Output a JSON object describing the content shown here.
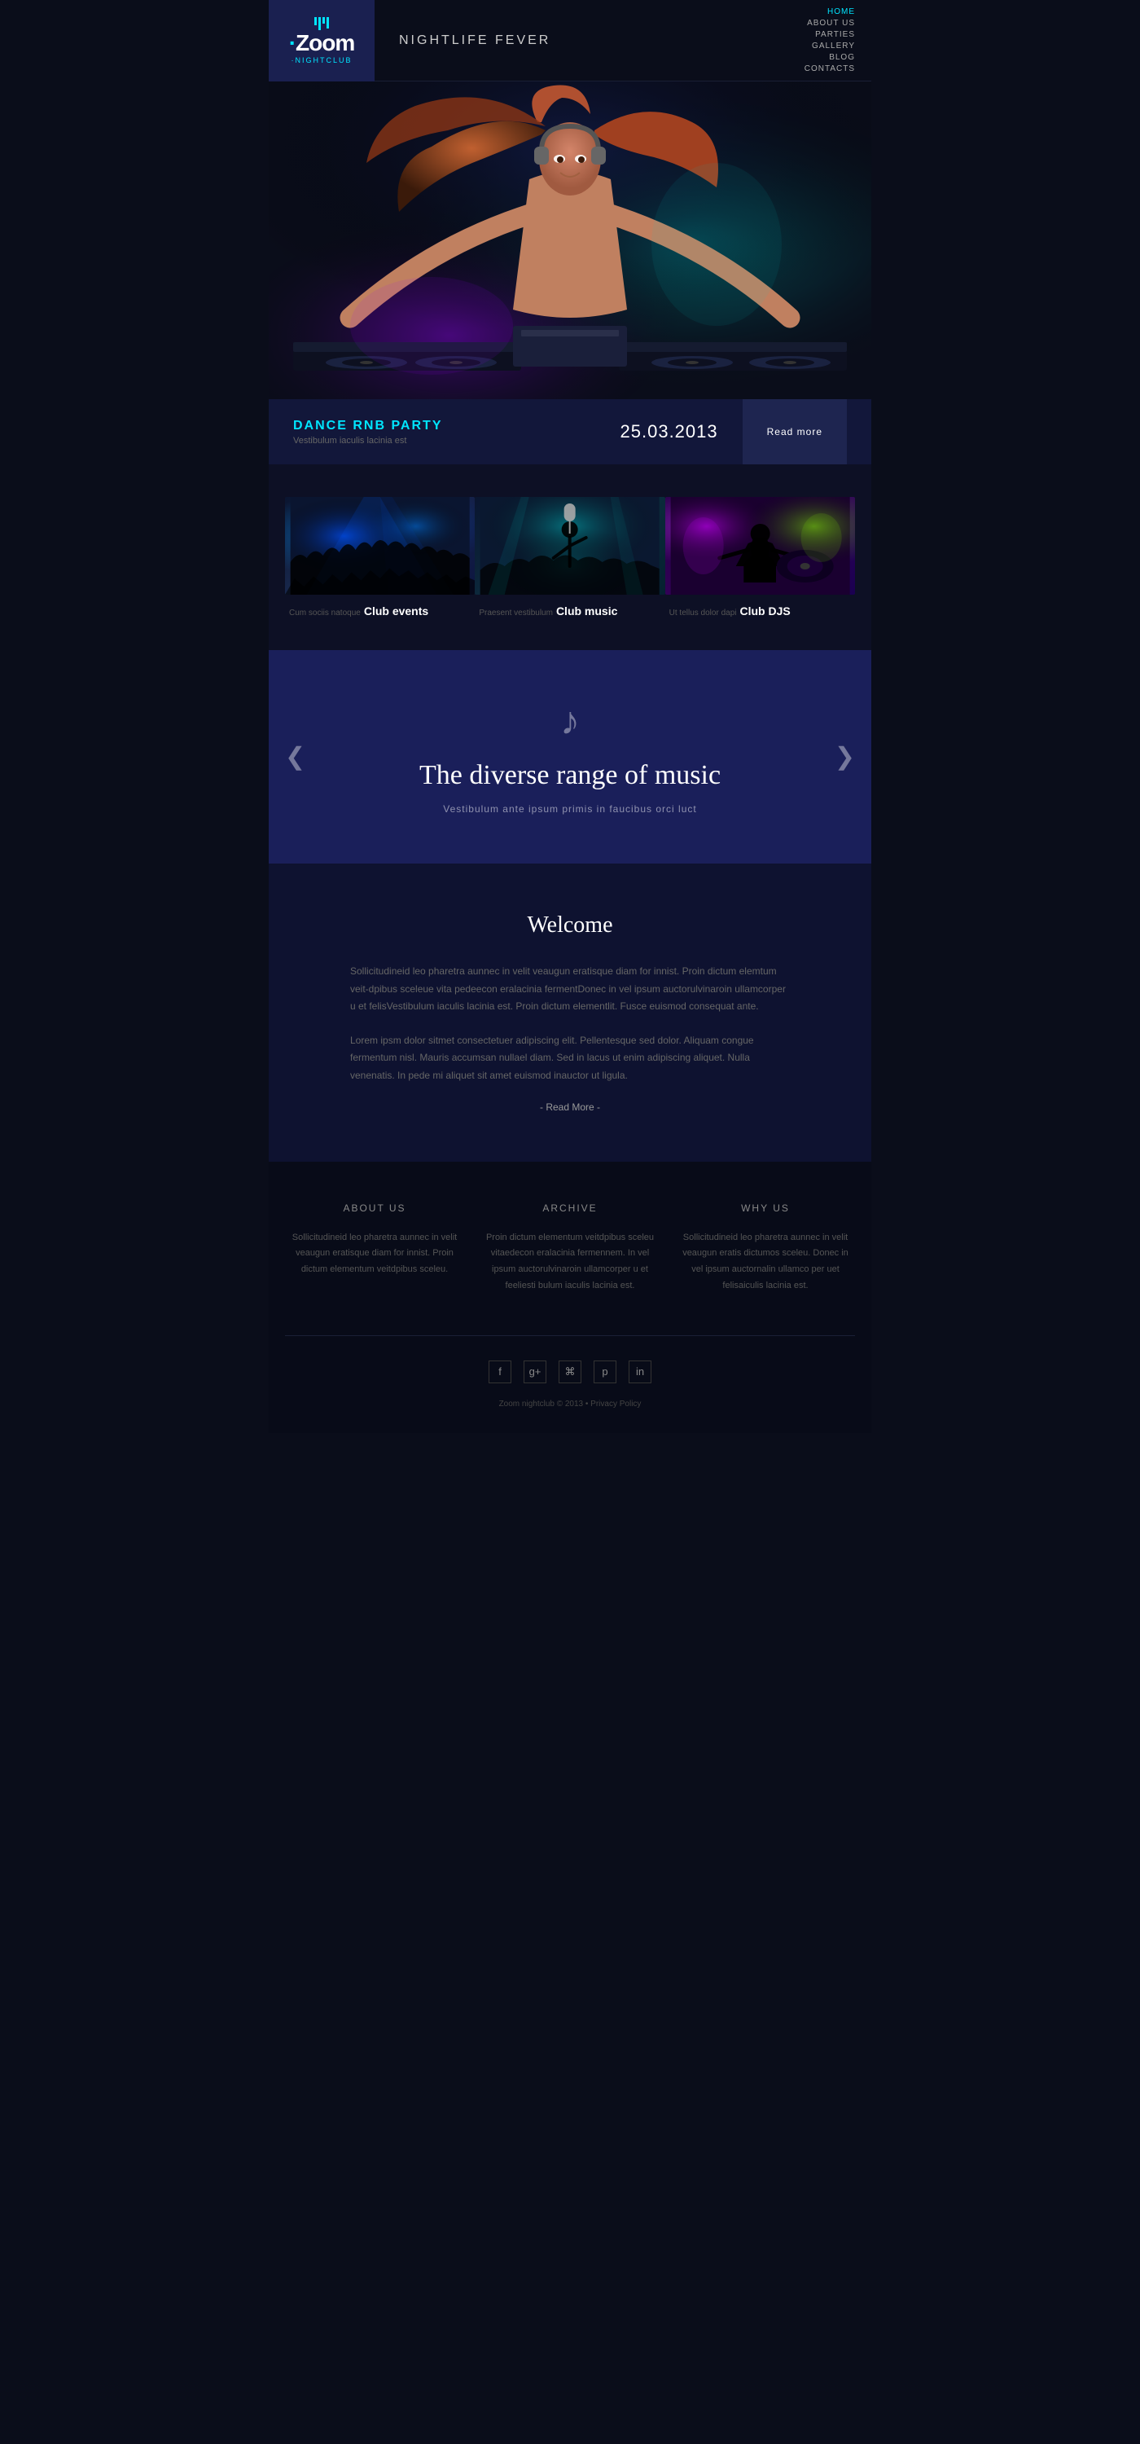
{
  "site": {
    "logo": {
      "main": "·Zoom",
      "sub": "·NIGHTCLUB",
      "dot": "·"
    },
    "header_title": "NIGHTLIFE FEVER",
    "nav": [
      {
        "label": "HOME",
        "active": true
      },
      {
        "label": "ABOUT US",
        "active": false
      },
      {
        "label": "PARTIES",
        "active": false
      },
      {
        "label": "GALLERY",
        "active": false
      },
      {
        "label": "BLOG",
        "active": false
      },
      {
        "label": "CONTACTS",
        "active": false
      }
    ]
  },
  "event_bar": {
    "title": "DANCE RNB PARTY",
    "subtitle": "Vestibulum iaculis lacinia est",
    "date": "25.03.2013",
    "read_more": "Read more"
  },
  "cards": [
    {
      "prefix": "Cum sociis natoque",
      "title": "Club events",
      "type": "club-events"
    },
    {
      "prefix": "Praesent vestibulum",
      "title": "Club music",
      "type": "club-music"
    },
    {
      "prefix": "Ut tellus dolor dapi",
      "title": "Club DJS",
      "type": "club-djs"
    }
  ],
  "music_slider": {
    "icon": "♪",
    "title": "The diverse range of music",
    "subtitle": "Vestibulum ante ipsum primis in faucibus orci luct",
    "prev": "❮",
    "next": "❯"
  },
  "welcome": {
    "title": "Welcome",
    "paragraph1": "Sollicitudineid leo pharetra aunnec in velit veaugun eratisque diam for innist. Proin dictum elemtum veit-dpibus sceleue vita pedeecon eralacinia fermentDonec in vel ipsum auctorulvinaroin ullamcorper u et felisVestibulum iaculis lacinia est. Proin dictum elementlit. Fusce euismod consequat ante.",
    "paragraph2": "Lorem ipsm dolor sitmet consectetuer adipiscing elit. Pellentesque sed dolor. Aliquam congue fermentum nisl. Mauris accumsan nullael diam. Sed in lacus ut enim adipiscing aliquet. Nulla venenatis. In pede mi aliquet sit amet euismod inauctor ut ligula.",
    "read_more": "- Read More -"
  },
  "footer": {
    "cols": [
      {
        "title": "ABOUT US",
        "text": "Sollicitudineid leo pharetra aunnec in velit veaugun eratisque diam for innist. Proin dictum elementum veitdpibus sceleu."
      },
      {
        "title": "ARCHIVE",
        "text": "Proin dictum elementum veitdpibus sceleu vitaedecon eralacinia fermennem. In vel ipsum auctorulvinaroin ullamcorper u et feeliesti bulum iaculis lacinia est."
      },
      {
        "title": "WHY US",
        "text": "Sollicitudineid leo pharetra aunnec in velit veaugun eratis dictumos sceleu. Donec in vel ipsum auctornalin ullamco per uet felisaiculis lacinia est."
      }
    ],
    "social_icons": [
      "f",
      "g+",
      "rss",
      "p",
      "in"
    ],
    "copyright": "Zoom nightclub © 2013 • Privacy Policy"
  }
}
